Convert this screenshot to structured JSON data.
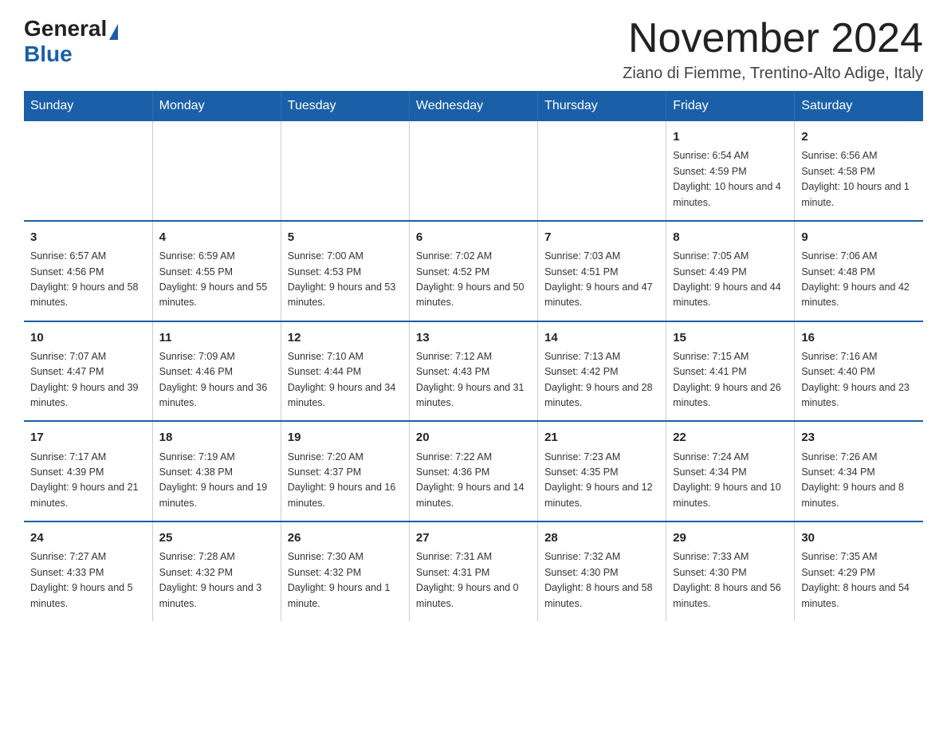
{
  "logo": {
    "general": "General",
    "blue": "Blue"
  },
  "header": {
    "title": "November 2024",
    "location": "Ziano di Fiemme, Trentino-Alto Adige, Italy"
  },
  "days_of_week": [
    "Sunday",
    "Monday",
    "Tuesday",
    "Wednesday",
    "Thursday",
    "Friday",
    "Saturday"
  ],
  "weeks": [
    [
      {
        "num": "",
        "info": ""
      },
      {
        "num": "",
        "info": ""
      },
      {
        "num": "",
        "info": ""
      },
      {
        "num": "",
        "info": ""
      },
      {
        "num": "",
        "info": ""
      },
      {
        "num": "1",
        "info": "Sunrise: 6:54 AM\nSunset: 4:59 PM\nDaylight: 10 hours and 4 minutes."
      },
      {
        "num": "2",
        "info": "Sunrise: 6:56 AM\nSunset: 4:58 PM\nDaylight: 10 hours and 1 minute."
      }
    ],
    [
      {
        "num": "3",
        "info": "Sunrise: 6:57 AM\nSunset: 4:56 PM\nDaylight: 9 hours and 58 minutes."
      },
      {
        "num": "4",
        "info": "Sunrise: 6:59 AM\nSunset: 4:55 PM\nDaylight: 9 hours and 55 minutes."
      },
      {
        "num": "5",
        "info": "Sunrise: 7:00 AM\nSunset: 4:53 PM\nDaylight: 9 hours and 53 minutes."
      },
      {
        "num": "6",
        "info": "Sunrise: 7:02 AM\nSunset: 4:52 PM\nDaylight: 9 hours and 50 minutes."
      },
      {
        "num": "7",
        "info": "Sunrise: 7:03 AM\nSunset: 4:51 PM\nDaylight: 9 hours and 47 minutes."
      },
      {
        "num": "8",
        "info": "Sunrise: 7:05 AM\nSunset: 4:49 PM\nDaylight: 9 hours and 44 minutes."
      },
      {
        "num": "9",
        "info": "Sunrise: 7:06 AM\nSunset: 4:48 PM\nDaylight: 9 hours and 42 minutes."
      }
    ],
    [
      {
        "num": "10",
        "info": "Sunrise: 7:07 AM\nSunset: 4:47 PM\nDaylight: 9 hours and 39 minutes."
      },
      {
        "num": "11",
        "info": "Sunrise: 7:09 AM\nSunset: 4:46 PM\nDaylight: 9 hours and 36 minutes."
      },
      {
        "num": "12",
        "info": "Sunrise: 7:10 AM\nSunset: 4:44 PM\nDaylight: 9 hours and 34 minutes."
      },
      {
        "num": "13",
        "info": "Sunrise: 7:12 AM\nSunset: 4:43 PM\nDaylight: 9 hours and 31 minutes."
      },
      {
        "num": "14",
        "info": "Sunrise: 7:13 AM\nSunset: 4:42 PM\nDaylight: 9 hours and 28 minutes."
      },
      {
        "num": "15",
        "info": "Sunrise: 7:15 AM\nSunset: 4:41 PM\nDaylight: 9 hours and 26 minutes."
      },
      {
        "num": "16",
        "info": "Sunrise: 7:16 AM\nSunset: 4:40 PM\nDaylight: 9 hours and 23 minutes."
      }
    ],
    [
      {
        "num": "17",
        "info": "Sunrise: 7:17 AM\nSunset: 4:39 PM\nDaylight: 9 hours and 21 minutes."
      },
      {
        "num": "18",
        "info": "Sunrise: 7:19 AM\nSunset: 4:38 PM\nDaylight: 9 hours and 19 minutes."
      },
      {
        "num": "19",
        "info": "Sunrise: 7:20 AM\nSunset: 4:37 PM\nDaylight: 9 hours and 16 minutes."
      },
      {
        "num": "20",
        "info": "Sunrise: 7:22 AM\nSunset: 4:36 PM\nDaylight: 9 hours and 14 minutes."
      },
      {
        "num": "21",
        "info": "Sunrise: 7:23 AM\nSunset: 4:35 PM\nDaylight: 9 hours and 12 minutes."
      },
      {
        "num": "22",
        "info": "Sunrise: 7:24 AM\nSunset: 4:34 PM\nDaylight: 9 hours and 10 minutes."
      },
      {
        "num": "23",
        "info": "Sunrise: 7:26 AM\nSunset: 4:34 PM\nDaylight: 9 hours and 8 minutes."
      }
    ],
    [
      {
        "num": "24",
        "info": "Sunrise: 7:27 AM\nSunset: 4:33 PM\nDaylight: 9 hours and 5 minutes."
      },
      {
        "num": "25",
        "info": "Sunrise: 7:28 AM\nSunset: 4:32 PM\nDaylight: 9 hours and 3 minutes."
      },
      {
        "num": "26",
        "info": "Sunrise: 7:30 AM\nSunset: 4:32 PM\nDaylight: 9 hours and 1 minute."
      },
      {
        "num": "27",
        "info": "Sunrise: 7:31 AM\nSunset: 4:31 PM\nDaylight: 9 hours and 0 minutes."
      },
      {
        "num": "28",
        "info": "Sunrise: 7:32 AM\nSunset: 4:30 PM\nDaylight: 8 hours and 58 minutes."
      },
      {
        "num": "29",
        "info": "Sunrise: 7:33 AM\nSunset: 4:30 PM\nDaylight: 8 hours and 56 minutes."
      },
      {
        "num": "30",
        "info": "Sunrise: 7:35 AM\nSunset: 4:29 PM\nDaylight: 8 hours and 54 minutes."
      }
    ]
  ]
}
